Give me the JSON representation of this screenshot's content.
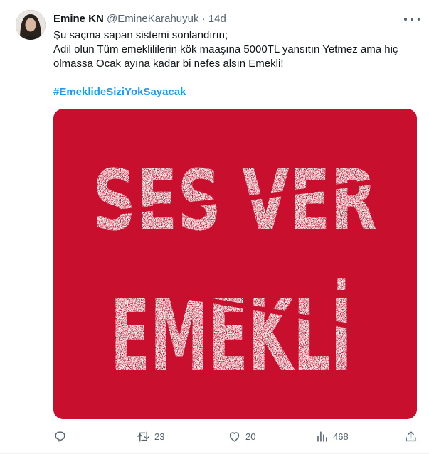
{
  "tweet": {
    "author_name": "Emine KN",
    "author_handle": "@EmineKarahuyuk",
    "separator": "·",
    "time": "14d",
    "lines": [
      "Şu saçma sapan sistemi sonlandırın;",
      "Adil olun Tüm emeklililerin kök maaşına 5000TL yansıtın Yetmez ama hiç",
      "olmassa Ocak ayına kadar bi nefes alsın Emekli!"
    ],
    "hashtag": "#EmeklideSiziYokSayacak",
    "image": {
      "line1": "SES VER",
      "line2": "EMEKLİ",
      "background_color": "#c8102e",
      "text_color": "#f4f1ef"
    },
    "actions": {
      "reply": {
        "icon": "reply-icon",
        "count": ""
      },
      "retweet": {
        "icon": "retweet-icon",
        "count": "23"
      },
      "like": {
        "icon": "heart-icon",
        "count": "20"
      },
      "views": {
        "icon": "views-chart-icon",
        "count": "468"
      },
      "share": {
        "icon": "share-icon",
        "count": ""
      }
    },
    "colors": {
      "text": "#0f1419",
      "secondary": "#536471",
      "link": "#1d9bf0"
    }
  }
}
